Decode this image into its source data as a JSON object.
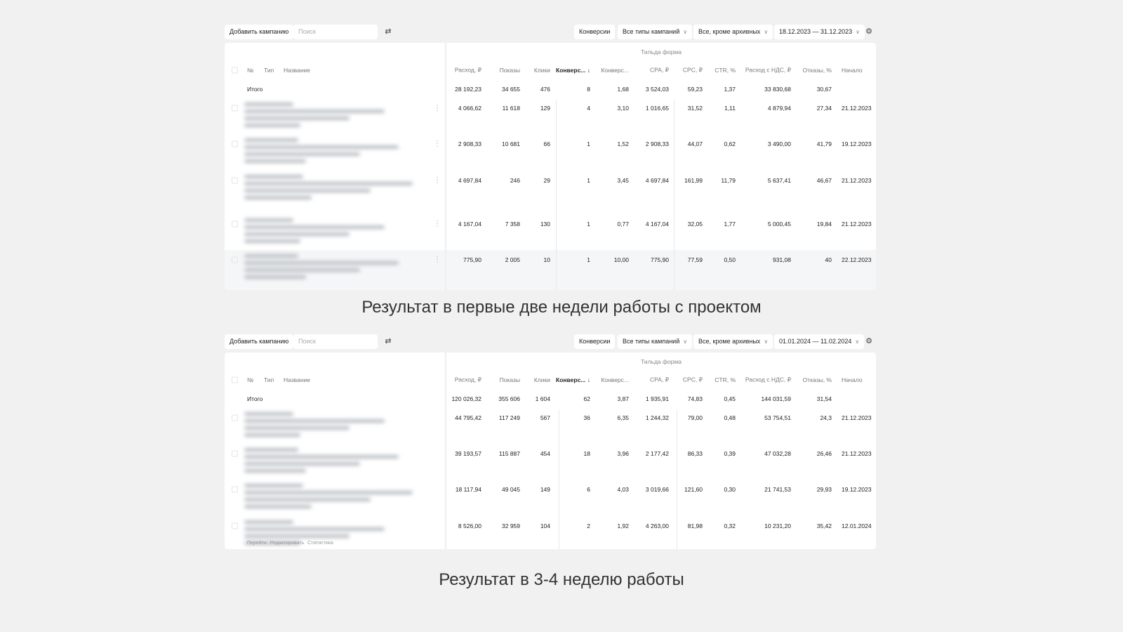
{
  "panels": [
    {
      "toolbar": {
        "add_campaign": "Добавить кампанию",
        "search_placeholder": "Поиск",
        "conversions": "Конверсии",
        "campaign_types": "Все типы кампаний",
        "status_filter": "Все, кроме архивных",
        "date_range": "18.12.2023 — 31.12.2023"
      },
      "group_label": "Тильда форма",
      "headers": [
        "№",
        "Тип",
        "Название",
        "Расход, ₽",
        "Показы",
        "Клики",
        "Конверс... ↓",
        "Конверс...",
        "CPA, ₽",
        "CPC, ₽",
        "CTR, %",
        "Расход с НДС, ₽",
        "Отказы, %",
        "Начало"
      ],
      "total": [
        "Итого",
        "28 192,23",
        "34 655",
        "476",
        "8",
        "1,68",
        "3 524,03",
        "59,23",
        "1,37",
        "33 830,68",
        "30,67",
        ""
      ],
      "rows": [
        [
          "4 066,62",
          "11 618",
          "129",
          "4",
          "3,10",
          "1 016,65",
          "31,52",
          "1,11",
          "4 879,94",
          "27,34",
          "21.12.2023"
        ],
        [
          "2 908,33",
          "10 681",
          "66",
          "1",
          "1,52",
          "2 908,33",
          "44,07",
          "0,62",
          "3 490,00",
          "41,79",
          "19.12.2023"
        ],
        [
          "4 697,84",
          "246",
          "29",
          "1",
          "3,45",
          "4 697,84",
          "161,99",
          "11,79",
          "5 637,41",
          "46,67",
          "21.12.2023"
        ],
        [
          "4 167,04",
          "7 358",
          "130",
          "1",
          "0,77",
          "4 167,04",
          "32,05",
          "1,77",
          "5 000,45",
          "19,84",
          "21.12.2023"
        ],
        [
          "775,90",
          "2 005",
          "10",
          "1",
          "10,00",
          "775,90",
          "77,59",
          "0,50",
          "931,08",
          "40",
          "22.12.2023"
        ]
      ],
      "caption": "Результат в первые две недели работы с проектом"
    },
    {
      "toolbar": {
        "add_campaign": "Добавить кампанию",
        "search_placeholder": "Поиск",
        "conversions": "Конверсии",
        "campaign_types": "Все типы кампаний",
        "status_filter": "Все, кроме архивных",
        "date_range": "01.01.2024 — 11.02.2024"
      },
      "group_label": "Тильда форма",
      "headers": [
        "№",
        "Тип",
        "Название",
        "Расход, ₽",
        "Показы",
        "Клики",
        "Конверс... ↓",
        "Конверс...",
        "CPA, ₽",
        "CPC, ₽",
        "CTR, %",
        "Расход с НДС, ₽",
        "Отказы, %",
        "Начало"
      ],
      "total": [
        "Итого",
        "120 026,32",
        "355 606",
        "1 604",
        "62",
        "3,87",
        "1 935,91",
        "74,83",
        "0,45",
        "144 031,59",
        "31,54",
        ""
      ],
      "rows": [
        [
          "44 795,42",
          "117 249",
          "567",
          "36",
          "6,35",
          "1 244,32",
          "79,00",
          "0,48",
          "53 754,51",
          "24,3",
          "21.12.2023"
        ],
        [
          "39 193,57",
          "115 887",
          "454",
          "18",
          "3,96",
          "2 177,42",
          "86,33",
          "0,39",
          "47 032,28",
          "26,46",
          "21.12.2023"
        ],
        [
          "18 117,94",
          "49 045",
          "149",
          "6",
          "4,03",
          "3 019,66",
          "121,60",
          "0,30",
          "21 741,53",
          "29,93",
          "19.12.2023"
        ],
        [
          "8 526,00",
          "32 959",
          "104",
          "2",
          "1,92",
          "4 263,00",
          "81,98",
          "0,32",
          "10 231,20",
          "35,42",
          "12.01.2024"
        ]
      ],
      "row_actions": [
        "Перейти",
        "Редактировать",
        "Статистика"
      ],
      "caption": "Результат в 3-4 неделю работы"
    }
  ]
}
